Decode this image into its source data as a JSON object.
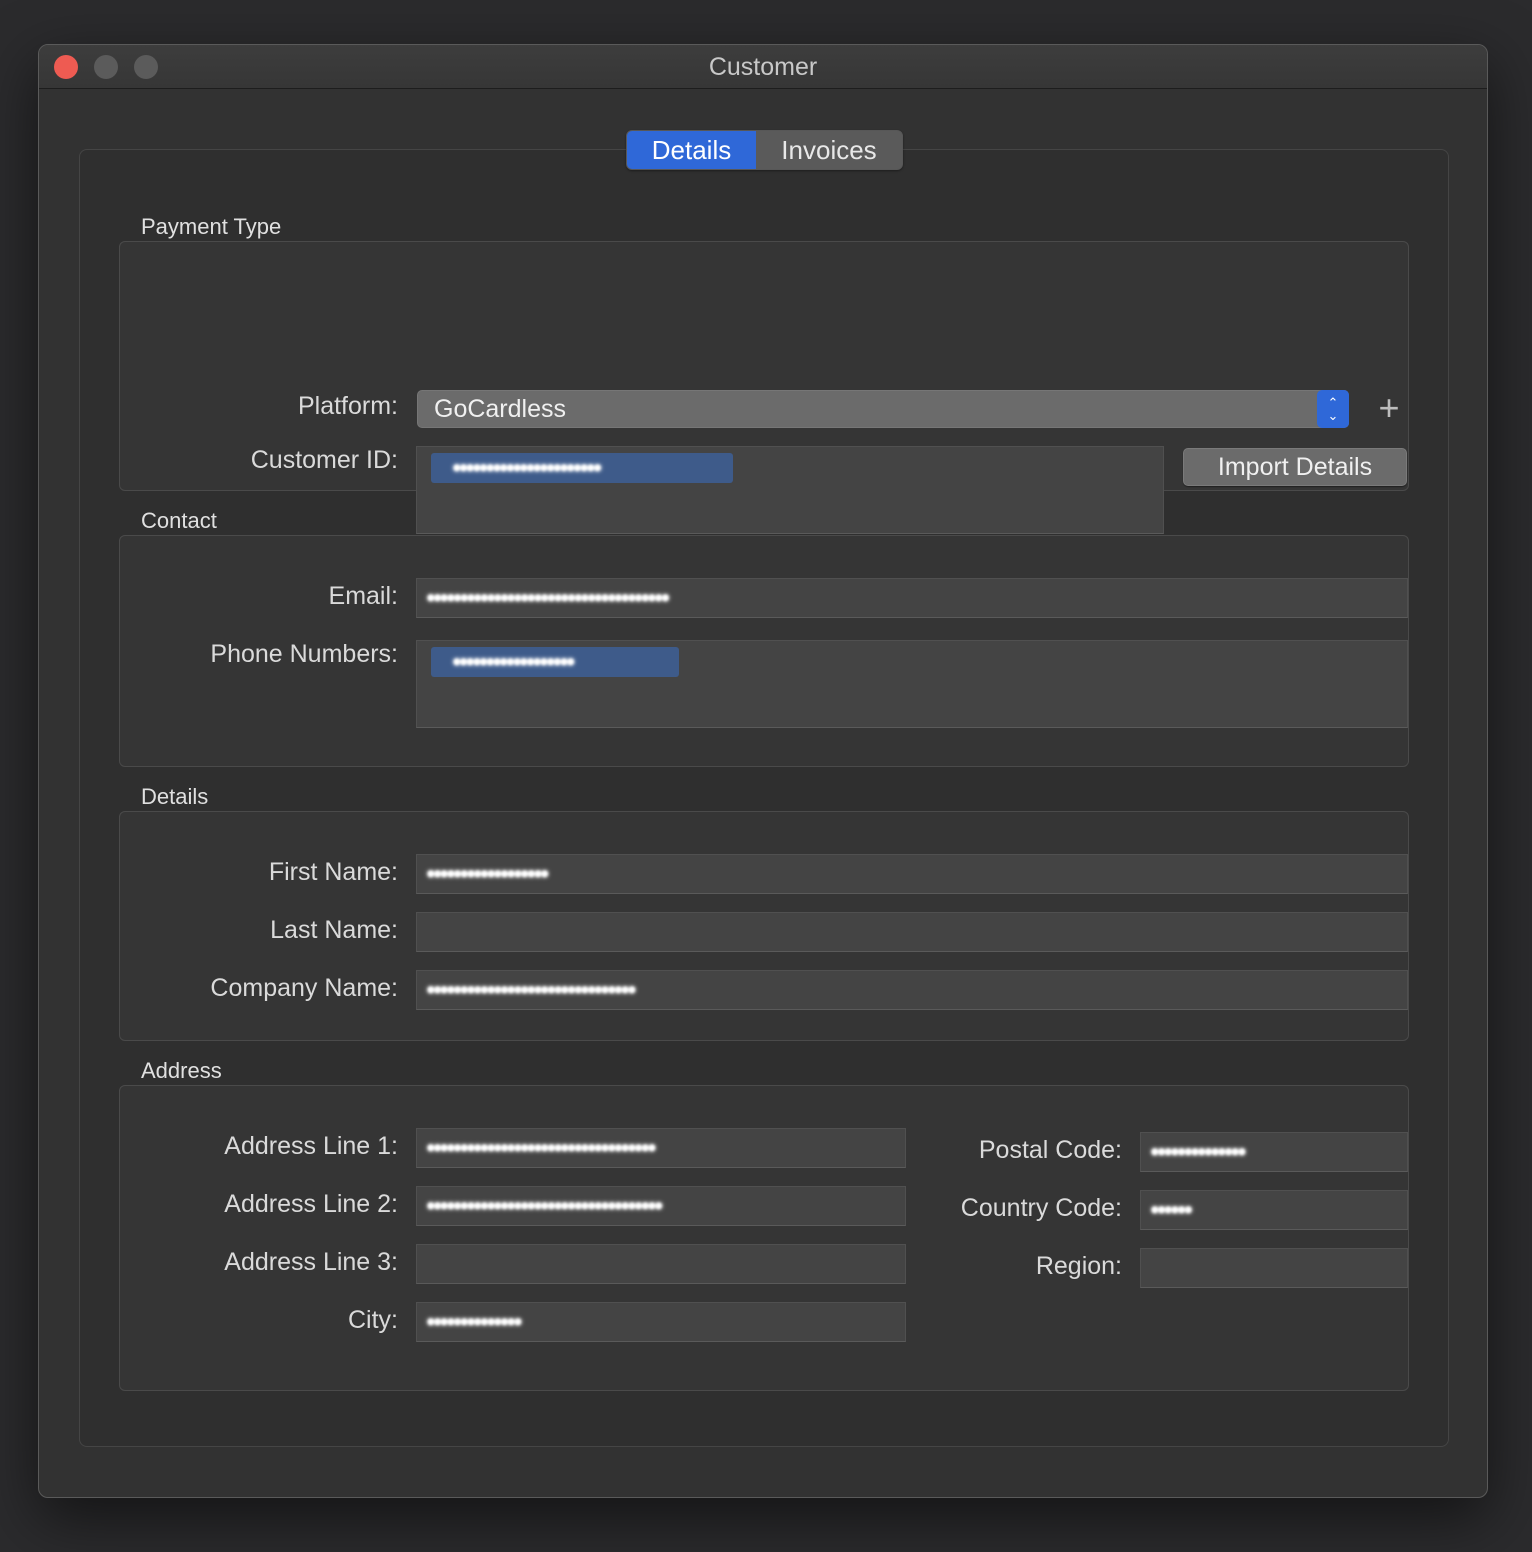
{
  "window": {
    "title": "Customer"
  },
  "tabs": [
    {
      "label": "Details",
      "active": true
    },
    {
      "label": "Invoices",
      "active": false
    }
  ],
  "payment": {
    "group_label": "Payment Type",
    "platform_label": "Platform:",
    "platform_value": "GoCardless",
    "customer_id_label": "Customer ID:",
    "customer_id_token": "••••••••••••••••••••••",
    "import_button": "Import Details"
  },
  "contact": {
    "group_label": "Contact",
    "email_label": "Email:",
    "email_value": "••••••••••••••••••••••••••••••••••••",
    "phone_label": "Phone Numbers:",
    "phone_token": "••••••••••••••••••"
  },
  "details": {
    "group_label": "Details",
    "first_name_label": "First Name:",
    "first_name_value": "••••••••••••••••••",
    "last_name_label": "Last Name:",
    "last_name_value": "",
    "company_label": "Company Name:",
    "company_value": "•••••••••••••••••••••••••••••••"
  },
  "address": {
    "group_label": "Address",
    "line1_label": "Address Line 1:",
    "line1_value": "••••••••••••••••••••••••••••••••••",
    "line2_label": "Address Line 2:",
    "line2_value": "•••••••••••••••••••••••••••••••••••",
    "line3_label": "Address Line 3:",
    "line3_value": "",
    "city_label": "City:",
    "city_value": "••••••••••••••",
    "postal_label": "Postal Code:",
    "postal_value": "••••••••••••••",
    "country_label": "Country Code:",
    "country_value": "••••••",
    "region_label": "Region:",
    "region_value": ""
  },
  "colors": {
    "accent": "#2f68d8",
    "close": "#ee5b52",
    "background": "#323232"
  }
}
